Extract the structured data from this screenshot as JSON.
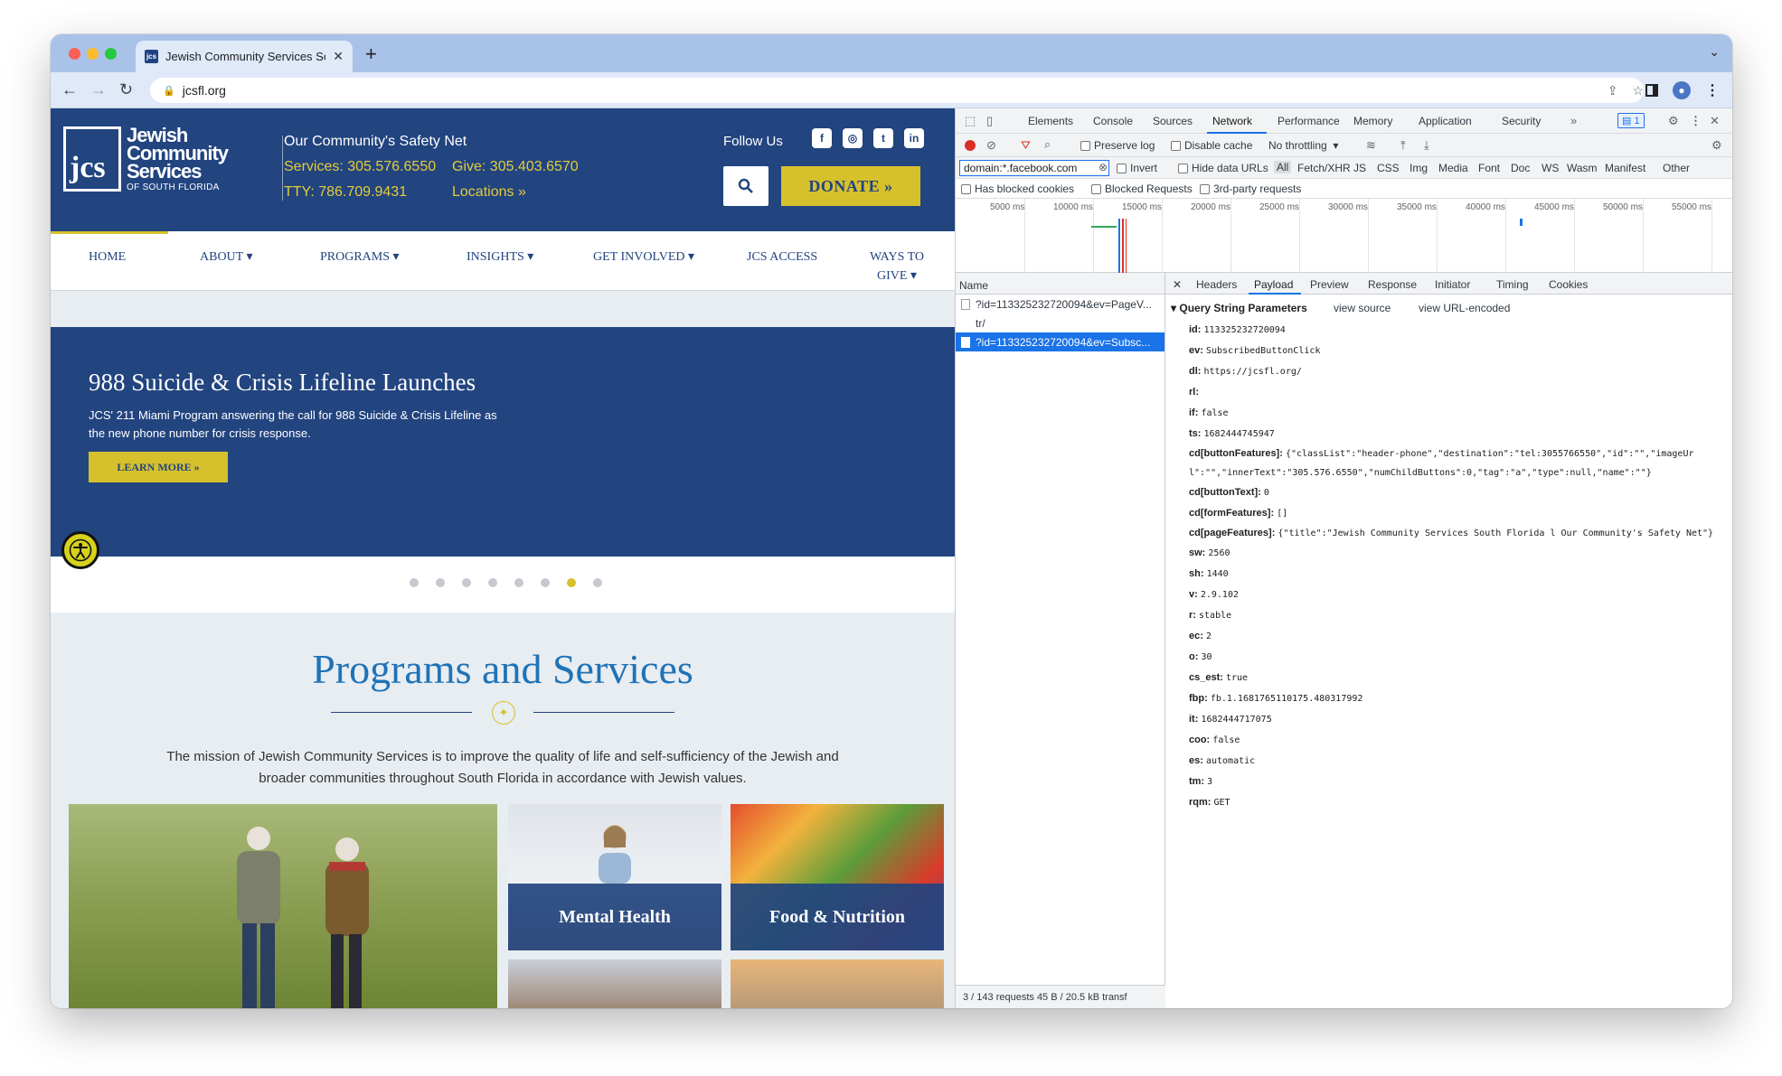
{
  "browser": {
    "tab_title": "Jewish Community Services So",
    "url": "jcsfl.org"
  },
  "site": {
    "logo": {
      "line1": "Jewish",
      "line2": "Community",
      "line3": "Services",
      "sub": "OF SOUTH FLORIDA",
      "mark": "jcs"
    },
    "tagline": "Our Community's Safety Net",
    "services_phone": "Services: 305.576.6550",
    "give_phone": "Give: 305.403.6570",
    "tty": "TTY: 786.709.9431",
    "locations": "Locations »",
    "follow_us": "Follow Us",
    "donate": "DONATE »",
    "nav": {
      "home": "HOME",
      "about": "ABOUT ▾",
      "programs": "PROGRAMS ▾",
      "insights": "INSIGHTS ▾",
      "get_involved": "GET INVOLVED ▾",
      "jcs_access": "JCS ACCESS",
      "ways_to_give_1": "WAYS TO",
      "ways_to_give_2": "GIVE ▾"
    },
    "hero": {
      "title": "988 Suicide & Crisis Lifeline Launches",
      "desc": "JCS' 211 Miami Program answering the call for 988 Suicide & Crisis Lifeline as the new phone number for crisis response.",
      "button": "LEARN MORE »"
    },
    "carousel": {
      "count": 8,
      "active_index": 6
    },
    "programs_title": "Programs and Services",
    "mission": "The mission of Jewish Community Services is to improve the quality of life and self-sufficiency of the Jewish and broader communities throughout South Florida in accordance with Jewish values.",
    "tiles": {
      "mental_health": "Mental Health",
      "food_nutrition": "Food & Nutrition"
    }
  },
  "devtools": {
    "tabs": [
      "Elements",
      "Console",
      "Sources",
      "Network",
      "Performance",
      "Memory",
      "Application",
      "Security"
    ],
    "active_tab": "Network",
    "badge": "1",
    "controls": {
      "preserve_log": "Preserve log",
      "disable_cache": "Disable cache",
      "throttling": "No throttling"
    },
    "filter": {
      "value": "domain:*.facebook.com",
      "invert": "Invert",
      "hide_data": "Hide data URLs"
    },
    "types": [
      "All",
      "Fetch/XHR",
      "JS",
      "CSS",
      "Img",
      "Media",
      "Font",
      "Doc",
      "WS",
      "Wasm",
      "Manifest",
      "Other"
    ],
    "blocked": {
      "blocked_cookies": "Has blocked cookies",
      "blocked_requests": "Blocked Requests",
      "third_party": "3rd-party requests"
    },
    "timeline_labels": [
      "5000 ms",
      "10000 ms",
      "15000 ms",
      "20000 ms",
      "25000 ms",
      "30000 ms",
      "35000 ms",
      "40000 ms",
      "45000 ms",
      "50000 ms",
      "55000 ms"
    ],
    "name_header": "Name",
    "requests": [
      "?id=113325232720094&ev=PageV...",
      "tr/",
      "?id=113325232720094&ev=Subsc..."
    ],
    "footer": "3 / 143 requests   45 B / 20.5 kB transf",
    "detail_tabs": [
      "Headers",
      "Payload",
      "Preview",
      "Response",
      "Initiator",
      "Timing",
      "Cookies"
    ],
    "qsp": {
      "title": "Query String Parameters",
      "view_source": "view source",
      "view_url": "view URL-encoded"
    },
    "params": [
      {
        "k": "id:",
        "v": "113325232720094"
      },
      {
        "k": "ev:",
        "v": "SubscribedButtonClick"
      },
      {
        "k": "dl:",
        "v": "https://jcsfl.org/"
      },
      {
        "k": "rl:",
        "v": ""
      },
      {
        "k": "if:",
        "v": "false"
      },
      {
        "k": "ts:",
        "v": "1682444745947"
      },
      {
        "k": "cd[buttonFeatures]:",
        "v": "{\"classList\":\"header-phone\",\"destination\":\"tel:3055766550\",\"id\":\"\",\"imageUrl\":\"\",\"innerText\":\"305.576.6550\",\"numChildButtons\":0,\"tag\":\"a\",\"type\":null,\"name\":\"\"}"
      },
      {
        "k": "cd[buttonText]:",
        "v": "0"
      },
      {
        "k": "cd[formFeatures]:",
        "v": "[]"
      },
      {
        "k": "cd[pageFeatures]:",
        "v": "{\"title\":\"Jewish Community Services South Florida l Our Community's Safety Net\"}"
      },
      {
        "k": "sw:",
        "v": "2560"
      },
      {
        "k": "sh:",
        "v": "1440"
      },
      {
        "k": "v:",
        "v": "2.9.102"
      },
      {
        "k": "r:",
        "v": "stable"
      },
      {
        "k": "ec:",
        "v": "2"
      },
      {
        "k": "o:",
        "v": "30"
      },
      {
        "k": "cs_est:",
        "v": "true"
      },
      {
        "k": "fbp:",
        "v": "fb.1.1681765110175.480317992"
      },
      {
        "k": "it:",
        "v": "1682444717075"
      },
      {
        "k": "coo:",
        "v": "false"
      },
      {
        "k": "es:",
        "v": "automatic"
      },
      {
        "k": "tm:",
        "v": "3"
      },
      {
        "k": "rqm:",
        "v": "GET"
      }
    ]
  }
}
